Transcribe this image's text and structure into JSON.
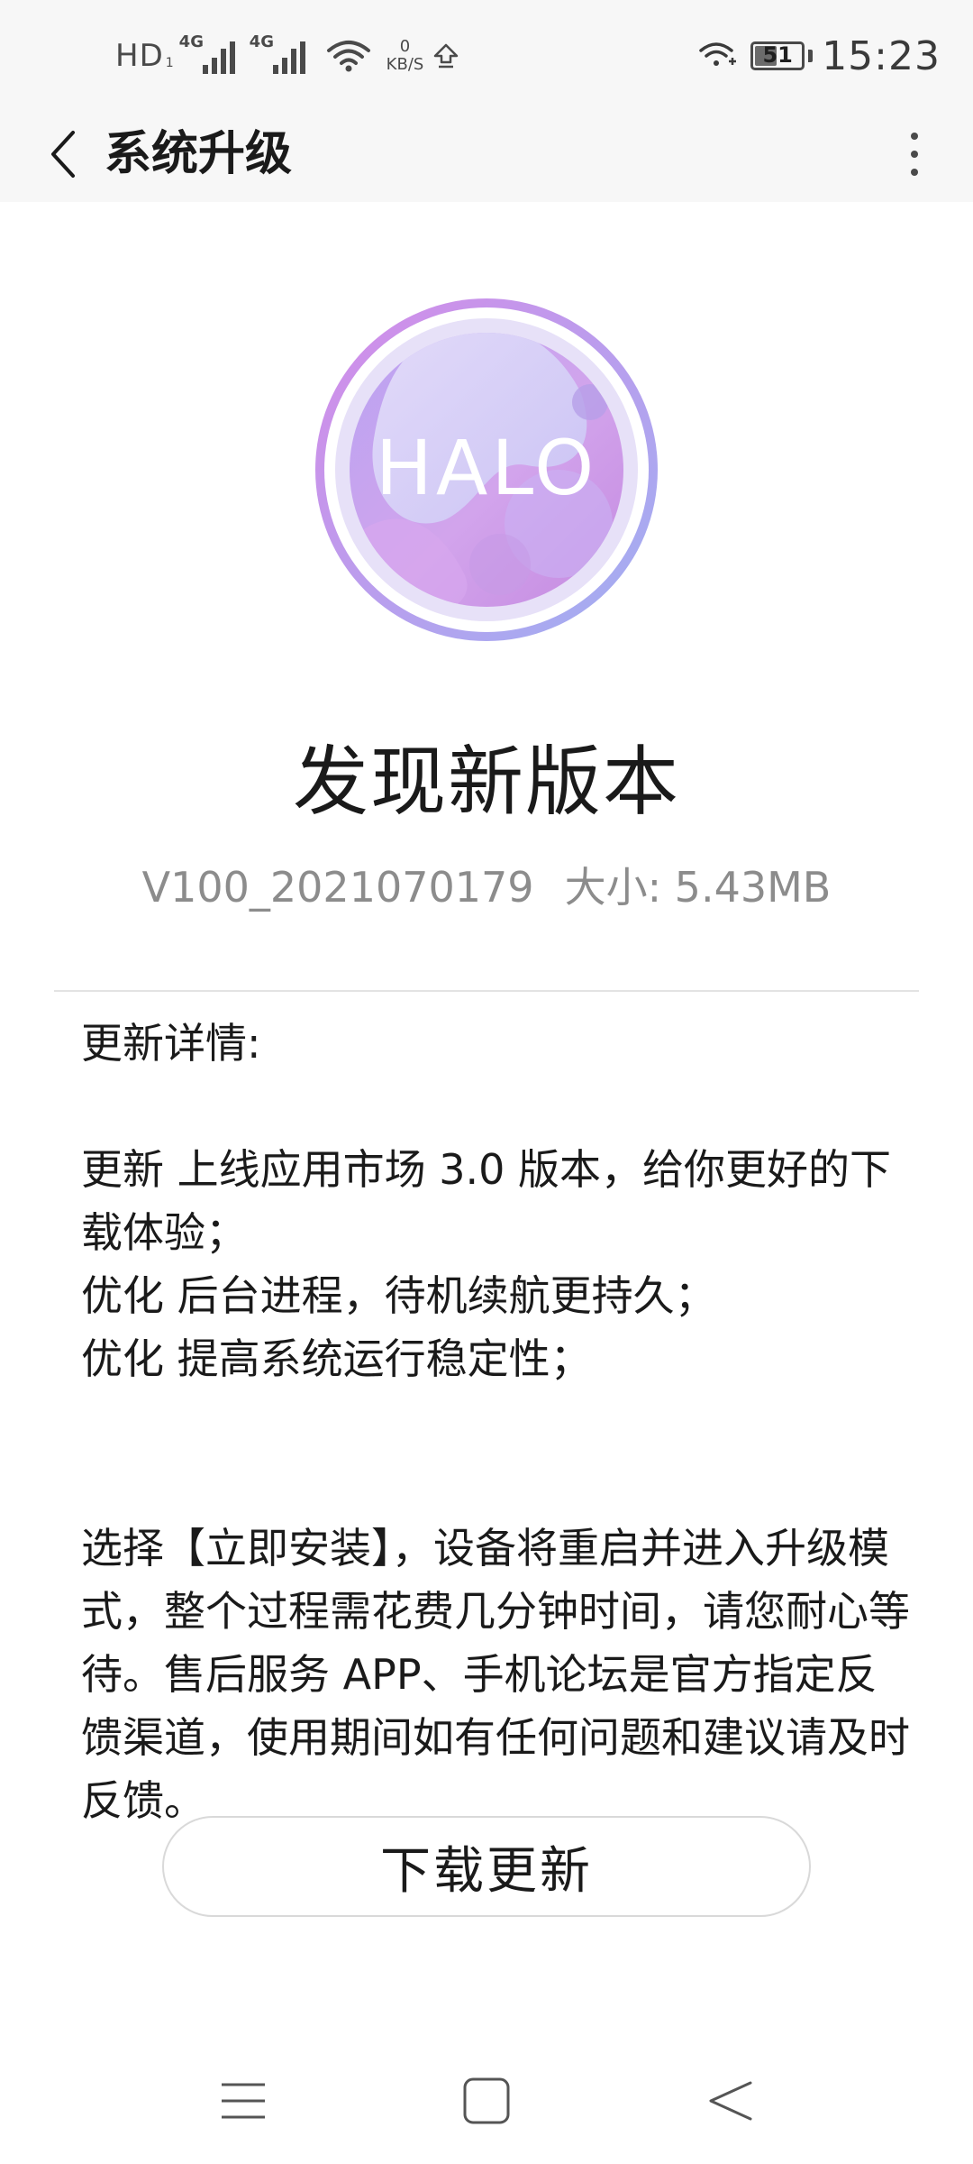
{
  "status_bar": {
    "hd": "HD",
    "hd_sub": "1",
    "net1_label": "4G",
    "net2_label": "4G",
    "speed_value": "0",
    "speed_unit": "KB/S",
    "battery_level": "51",
    "time": "15:23"
  },
  "app_bar": {
    "title": "系统升级"
  },
  "logo": {
    "text": "HALO"
  },
  "update": {
    "headline": "发现新版本",
    "version": "V100_2021070179",
    "size": "大小: 5.43MB",
    "details_heading": "更新详情:",
    "notes": [
      "更新 上线应用市场 3.0 版本，给你更好的下载体验；",
      "优化 后台进程，待机续航更持久；",
      "优化 提高系统运行稳定性；"
    ],
    "tip": "选择【立即安装】，设备将重启并进入升级模式，整个过程需花费几分钟时间，请您耐心等待。售后服务 APP、手机论坛是官方指定反馈渠道，使用期间如有任何问题和建议请及时反馈。",
    "download_label": "下载更新"
  },
  "icons": {
    "back": "chevron-left-icon",
    "more": "more-vertical-icon",
    "nav_menu": "menu-icon",
    "nav_home": "square-home-icon",
    "nav_back": "triangle-back-icon"
  },
  "colors": {
    "header_bg": "#f7f7f7",
    "logo_ring_start": "#d58be8",
    "logo_ring_end": "#9fb0f2",
    "secondary_text": "#8c8c8c"
  }
}
